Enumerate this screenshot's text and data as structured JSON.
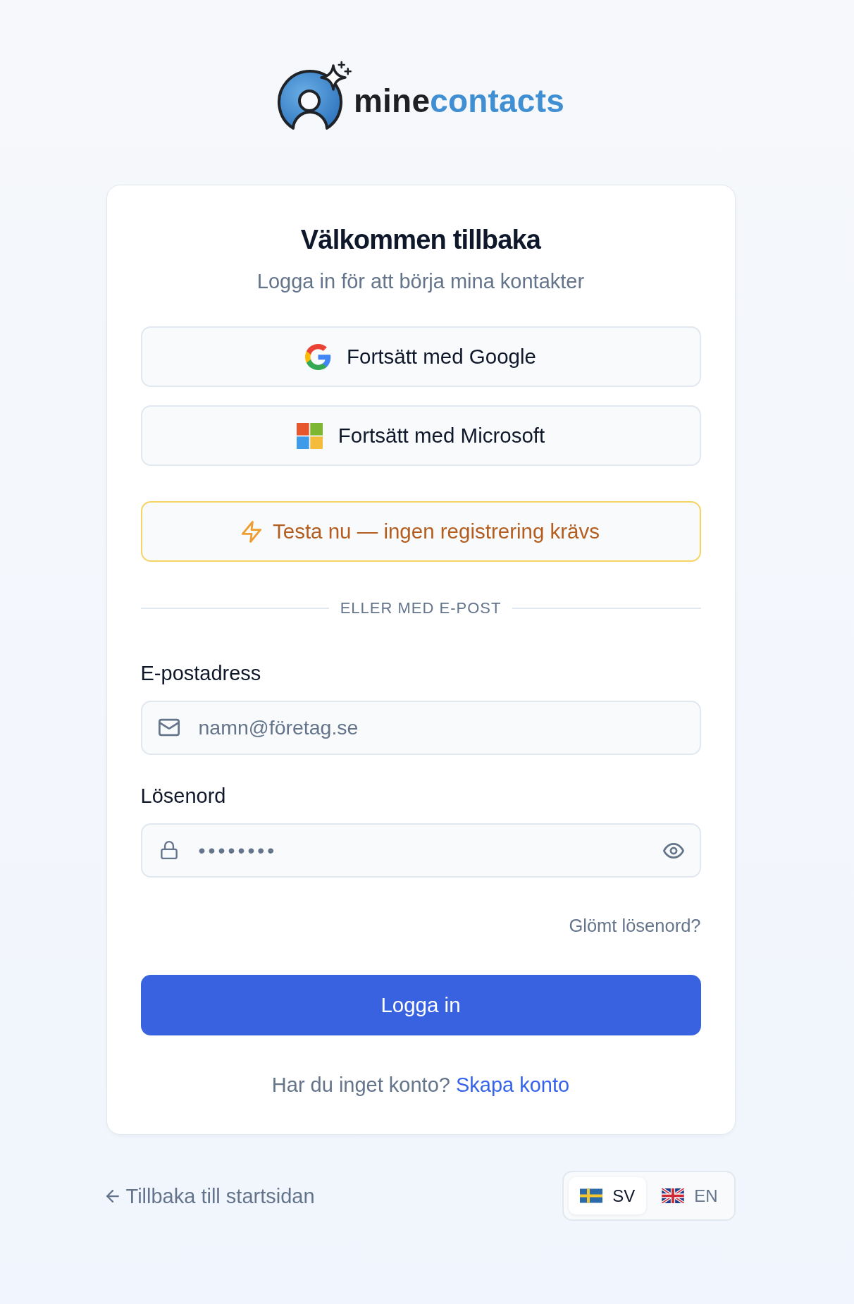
{
  "logo": {
    "text_dark": "mine",
    "text_accent": "contacts"
  },
  "card": {
    "title": "Välkommen tillbaka",
    "subtitle": "Logga in för att börja mina kontakter"
  },
  "providers": [
    {
      "kind": "google",
      "label": "Fortsätt med Google"
    },
    {
      "kind": "microsoft",
      "label": "Fortsätt med Microsoft"
    }
  ],
  "demo_button": {
    "label": "Testa nu — ingen registrering krävs"
  },
  "divider": {
    "label": "ELLER MED E-POST"
  },
  "email": {
    "label": "E-postadress",
    "placeholder": "namn@företag.se"
  },
  "password": {
    "label": "Lösenord",
    "placeholder": "••••••••"
  },
  "forgot_link": "Glömt lösenord?",
  "submit_button": "Logga in",
  "signup": {
    "prompt": "Har du inget konto?",
    "link": "Skapa konto"
  },
  "back_link": "Tillbaka till startsidan",
  "languages": [
    {
      "kind": "se",
      "code": "SV",
      "selected": true
    },
    {
      "kind": "gb",
      "code": "EN",
      "selected": false
    }
  ]
}
